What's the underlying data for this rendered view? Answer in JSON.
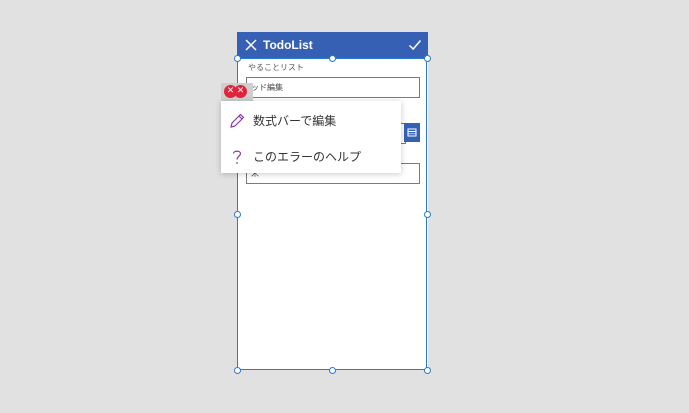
{
  "header": {
    "title": "TodoList"
  },
  "form": {
    "field_label": "やることリスト",
    "field1_value": "ッド編集",
    "field3_value": "米"
  },
  "context_menu": {
    "items": [
      {
        "label": "数式バーで編集",
        "icon": "pencil-icon"
      },
      {
        "label": "このエラーのヘルプ",
        "icon": "question-icon"
      }
    ]
  },
  "colors": {
    "header": "#3560b4",
    "selection": "#2a7bd0",
    "error": "#e0243a",
    "menu_icon": "#8a3aa0"
  }
}
